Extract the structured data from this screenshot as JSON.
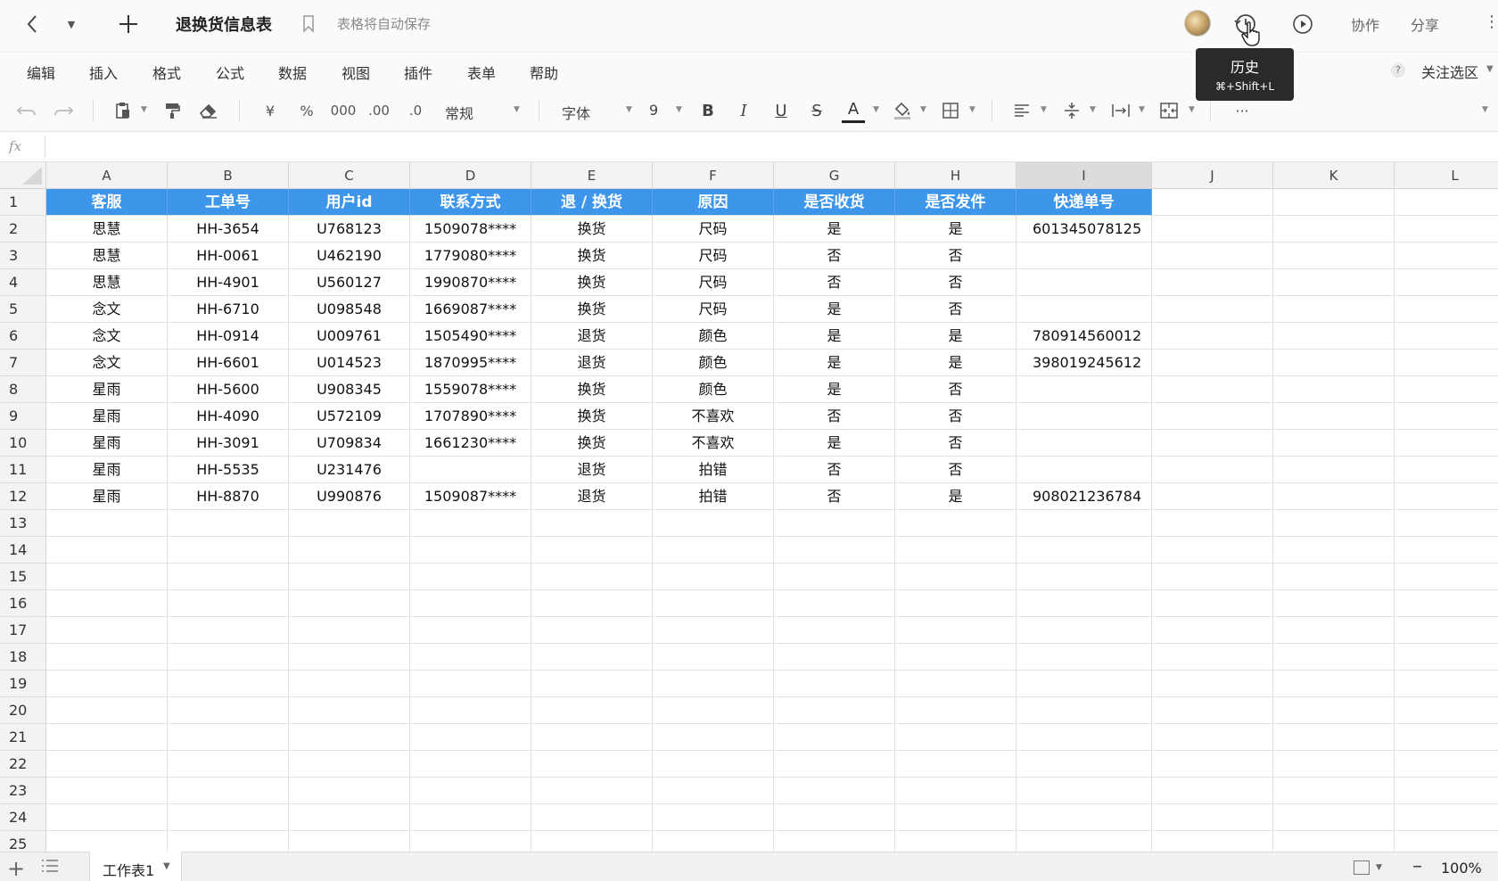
{
  "titlebar": {
    "doc_title": "退换货信息表",
    "autosave_text": "表格将自动保存",
    "collab_label": "协作",
    "share_label": "分享"
  },
  "tooltip": {
    "title": "历史",
    "shortcut": "⌘+Shift+L"
  },
  "menu": {
    "items": [
      "编辑",
      "插入",
      "格式",
      "公式",
      "数据",
      "视图",
      "插件",
      "表单",
      "帮助"
    ],
    "focus_selection": "关注选区"
  },
  "toolbar": {
    "currency": "¥",
    "percent": "%",
    "thousands": "000",
    "inc_decimal": ".00",
    "dec_decimal": ".0",
    "number_format": "常规",
    "font": "字体",
    "font_size": "9",
    "bold": "B",
    "italic": "I",
    "underline": "U",
    "strike": "S",
    "font_color": "A",
    "more": "···",
    "accent_color": "#3d96ea"
  },
  "formula_bar": {
    "fx_label": "fx"
  },
  "sheet": {
    "columns": [
      "A",
      "B",
      "C",
      "D",
      "E",
      "F",
      "G",
      "H",
      "I",
      "J",
      "K",
      "L"
    ],
    "selected_column": "I",
    "row_numbers": [
      "1",
      "2",
      "3",
      "4",
      "5",
      "6",
      "7",
      "8",
      "9",
      "10",
      "11",
      "12",
      "13",
      "14",
      "15",
      "16",
      "17",
      "18",
      "19",
      "20",
      "21",
      "22",
      "23",
      "24",
      "25"
    ],
    "header_row": [
      "客服",
      "工单号",
      "用户id",
      "联系方式",
      "退 / 换货",
      "原因",
      "是否收货",
      "是否发件",
      "快递单号"
    ],
    "rows": [
      [
        "思慧",
        "HH-3654",
        "U768123",
        "1509078****",
        "换货",
        "尺码",
        "是",
        "是",
        "601345078125"
      ],
      [
        "思慧",
        "HH-0061",
        "U462190",
        "1779080****",
        "换货",
        "尺码",
        "否",
        "否",
        ""
      ],
      [
        "思慧",
        "HH-4901",
        "U560127",
        "1990870****",
        "换货",
        "尺码",
        "否",
        "否",
        ""
      ],
      [
        "念文",
        "HH-6710",
        "U098548",
        "1669087****",
        "换货",
        "尺码",
        "是",
        "否",
        ""
      ],
      [
        "念文",
        "HH-0914",
        "U009761",
        "1505490****",
        "退货",
        "颜色",
        "是",
        "是",
        "780914560012"
      ],
      [
        "念文",
        "HH-6601",
        "U014523",
        "1870995****",
        "退货",
        "颜色",
        "是",
        "是",
        "398019245612"
      ],
      [
        "星雨",
        "HH-5600",
        "U908345",
        "1559078****",
        "换货",
        "颜色",
        "是",
        "否",
        ""
      ],
      [
        "星雨",
        "HH-4090",
        "U572109",
        "1707890****",
        "换货",
        "不喜欢",
        "否",
        "否",
        ""
      ],
      [
        "星雨",
        "HH-3091",
        "U709834",
        "1661230****",
        "换货",
        "不喜欢",
        "是",
        "否",
        ""
      ],
      [
        "星雨",
        "HH-5535",
        "U231476",
        "",
        "退货",
        "拍错",
        "否",
        "否",
        ""
      ],
      [
        "星雨",
        "HH-8870",
        "U990876",
        "1509087****",
        "退货",
        "拍错",
        "否",
        "是",
        "908021236784"
      ]
    ]
  },
  "bottombar": {
    "sheet_tab": "工作表1",
    "zoom": "100%"
  }
}
